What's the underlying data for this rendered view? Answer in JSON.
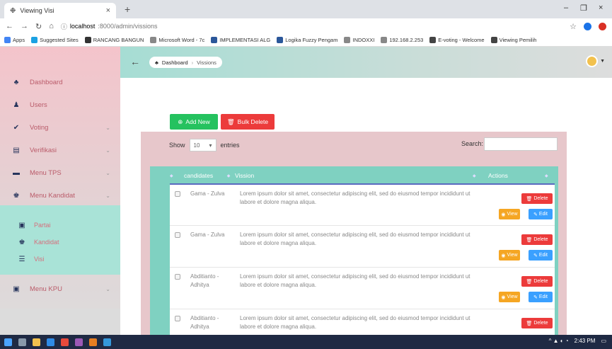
{
  "browser": {
    "tab_title": "Viewing Visi",
    "tab_close": "×",
    "new_tab": "+",
    "url_host": "localhost",
    "url_path": ":8000/admin/vissions",
    "win_min": "–",
    "win_max": "❐",
    "win_close": "×",
    "bookmarks": [
      {
        "label": "Apps",
        "color": "#4285f4"
      },
      {
        "label": "Suggested Sites",
        "color": "#1ba1e2"
      },
      {
        "label": "RANCANG BANGUN",
        "color": "#333333"
      },
      {
        "label": "Microsoft Word - 7c",
        "color": "#888888"
      },
      {
        "label": "IMPLEMENTASI ALG",
        "color": "#2b579a"
      },
      {
        "label": "Logika Fuzzy Pengam",
        "color": "#2b579a"
      },
      {
        "label": "INDOXXI",
        "color": "#888888"
      },
      {
        "label": "192.168.2.253",
        "color": "#888888"
      },
      {
        "label": "E-voting - Welcome",
        "color": "#444444"
      },
      {
        "label": "Viewing Pemilih",
        "color": "#444444"
      }
    ]
  },
  "breadcrumb": {
    "home": "Dashboard",
    "sep": "›",
    "current": "Vissions"
  },
  "sidebar": {
    "items": [
      {
        "label": "Dashboard",
        "icon": "♣",
        "caret": ""
      },
      {
        "label": "Users",
        "icon": "♟",
        "caret": ""
      },
      {
        "label": "Voting",
        "icon": "✔",
        "caret": "⌄"
      },
      {
        "label": "Verifikasi",
        "icon": "▤",
        "caret": "⌄"
      },
      {
        "label": "Menu TPS",
        "icon": "▬",
        "caret": "⌄"
      },
      {
        "label": "Menu Kandidat",
        "icon": "♚",
        "caret": "⌄"
      }
    ],
    "submenu": [
      {
        "label": "Partai",
        "icon": "▣"
      },
      {
        "label": "Kandidat",
        "icon": "♚"
      },
      {
        "label": "Visi",
        "icon": "☰"
      }
    ],
    "kpu": {
      "label": "Menu KPU",
      "icon": "▣",
      "caret": "⌄"
    }
  },
  "toolbar": {
    "add_label": "Add New",
    "bulk_label": "Bulk Delete"
  },
  "table_controls": {
    "show": "Show",
    "entries_value": "10",
    "entries": "entries",
    "search": "Search:"
  },
  "table": {
    "headers": {
      "candidates": "candidates",
      "vission": "Vission",
      "actions": "Actions"
    },
    "rows": [
      {
        "candidate": "Gama - Zulva",
        "vission": "Lorem ipsum dolor sit amet, consectetur adipiscing elit, sed do eiusmod tempor incididunt ut labore et dolore magna aliqua."
      },
      {
        "candidate": "Gama - Zulva",
        "vission": "Lorem ipsum dolor sit amet, consectetur adipiscing elit, sed do eiusmod tempor incididunt ut labore et dolore magna aliqua."
      },
      {
        "candidate": "Abditianto - Adhitya",
        "vission": "Lorem ipsum dolor sit amet, consectetur adipiscing elit, sed do eiusmod tempor incididunt ut labore et dolore magna aliqua."
      },
      {
        "candidate": "Abditianto - Adhitya",
        "vission": "Lorem ipsum dolor sit amet, consectetur adipiscing elit, sed do eiusmod tempor incididunt ut labore et dolore magna aliqua."
      }
    ],
    "delete_label": "Delete",
    "view_label": "View",
    "edit_label": "Edit"
  },
  "taskbar": {
    "time": "2:43 PM"
  }
}
